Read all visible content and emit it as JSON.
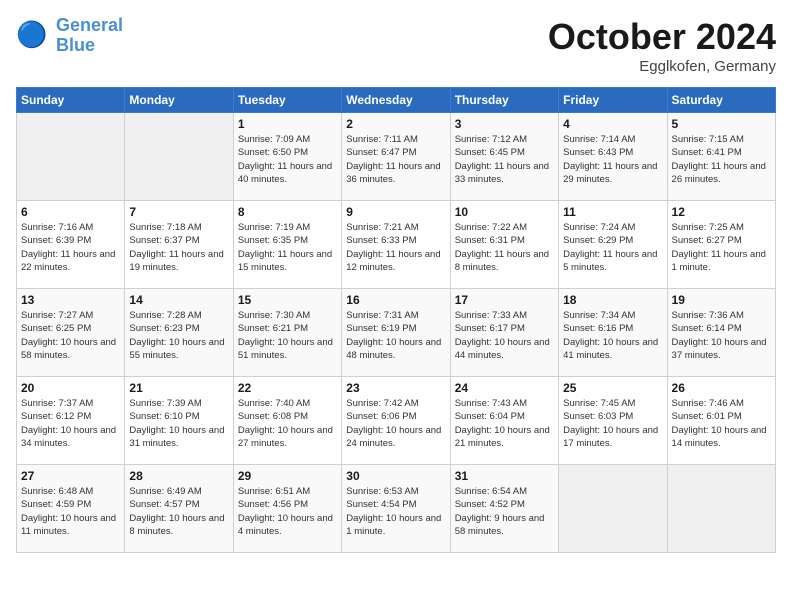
{
  "header": {
    "logo_line1": "General",
    "logo_line2": "Blue",
    "month": "October 2024",
    "location": "Egglkofen, Germany"
  },
  "weekdays": [
    "Sunday",
    "Monday",
    "Tuesday",
    "Wednesday",
    "Thursday",
    "Friday",
    "Saturday"
  ],
  "weeks": [
    [
      {
        "day": "",
        "info": ""
      },
      {
        "day": "",
        "info": ""
      },
      {
        "day": "1",
        "info": "Sunrise: 7:09 AM\nSunset: 6:50 PM\nDaylight: 11 hours and 40 minutes."
      },
      {
        "day": "2",
        "info": "Sunrise: 7:11 AM\nSunset: 6:47 PM\nDaylight: 11 hours and 36 minutes."
      },
      {
        "day": "3",
        "info": "Sunrise: 7:12 AM\nSunset: 6:45 PM\nDaylight: 11 hours and 33 minutes."
      },
      {
        "day": "4",
        "info": "Sunrise: 7:14 AM\nSunset: 6:43 PM\nDaylight: 11 hours and 29 minutes."
      },
      {
        "day": "5",
        "info": "Sunrise: 7:15 AM\nSunset: 6:41 PM\nDaylight: 11 hours and 26 minutes."
      }
    ],
    [
      {
        "day": "6",
        "info": "Sunrise: 7:16 AM\nSunset: 6:39 PM\nDaylight: 11 hours and 22 minutes."
      },
      {
        "day": "7",
        "info": "Sunrise: 7:18 AM\nSunset: 6:37 PM\nDaylight: 11 hours and 19 minutes."
      },
      {
        "day": "8",
        "info": "Sunrise: 7:19 AM\nSunset: 6:35 PM\nDaylight: 11 hours and 15 minutes."
      },
      {
        "day": "9",
        "info": "Sunrise: 7:21 AM\nSunset: 6:33 PM\nDaylight: 11 hours and 12 minutes."
      },
      {
        "day": "10",
        "info": "Sunrise: 7:22 AM\nSunset: 6:31 PM\nDaylight: 11 hours and 8 minutes."
      },
      {
        "day": "11",
        "info": "Sunrise: 7:24 AM\nSunset: 6:29 PM\nDaylight: 11 hours and 5 minutes."
      },
      {
        "day": "12",
        "info": "Sunrise: 7:25 AM\nSunset: 6:27 PM\nDaylight: 11 hours and 1 minute."
      }
    ],
    [
      {
        "day": "13",
        "info": "Sunrise: 7:27 AM\nSunset: 6:25 PM\nDaylight: 10 hours and 58 minutes."
      },
      {
        "day": "14",
        "info": "Sunrise: 7:28 AM\nSunset: 6:23 PM\nDaylight: 10 hours and 55 minutes."
      },
      {
        "day": "15",
        "info": "Sunrise: 7:30 AM\nSunset: 6:21 PM\nDaylight: 10 hours and 51 minutes."
      },
      {
        "day": "16",
        "info": "Sunrise: 7:31 AM\nSunset: 6:19 PM\nDaylight: 10 hours and 48 minutes."
      },
      {
        "day": "17",
        "info": "Sunrise: 7:33 AM\nSunset: 6:17 PM\nDaylight: 10 hours and 44 minutes."
      },
      {
        "day": "18",
        "info": "Sunrise: 7:34 AM\nSunset: 6:16 PM\nDaylight: 10 hours and 41 minutes."
      },
      {
        "day": "19",
        "info": "Sunrise: 7:36 AM\nSunset: 6:14 PM\nDaylight: 10 hours and 37 minutes."
      }
    ],
    [
      {
        "day": "20",
        "info": "Sunrise: 7:37 AM\nSunset: 6:12 PM\nDaylight: 10 hours and 34 minutes."
      },
      {
        "day": "21",
        "info": "Sunrise: 7:39 AM\nSunset: 6:10 PM\nDaylight: 10 hours and 31 minutes."
      },
      {
        "day": "22",
        "info": "Sunrise: 7:40 AM\nSunset: 6:08 PM\nDaylight: 10 hours and 27 minutes."
      },
      {
        "day": "23",
        "info": "Sunrise: 7:42 AM\nSunset: 6:06 PM\nDaylight: 10 hours and 24 minutes."
      },
      {
        "day": "24",
        "info": "Sunrise: 7:43 AM\nSunset: 6:04 PM\nDaylight: 10 hours and 21 minutes."
      },
      {
        "day": "25",
        "info": "Sunrise: 7:45 AM\nSunset: 6:03 PM\nDaylight: 10 hours and 17 minutes."
      },
      {
        "day": "26",
        "info": "Sunrise: 7:46 AM\nSunset: 6:01 PM\nDaylight: 10 hours and 14 minutes."
      }
    ],
    [
      {
        "day": "27",
        "info": "Sunrise: 6:48 AM\nSunset: 4:59 PM\nDaylight: 10 hours and 11 minutes."
      },
      {
        "day": "28",
        "info": "Sunrise: 6:49 AM\nSunset: 4:57 PM\nDaylight: 10 hours and 8 minutes."
      },
      {
        "day": "29",
        "info": "Sunrise: 6:51 AM\nSunset: 4:56 PM\nDaylight: 10 hours and 4 minutes."
      },
      {
        "day": "30",
        "info": "Sunrise: 6:53 AM\nSunset: 4:54 PM\nDaylight: 10 hours and 1 minute."
      },
      {
        "day": "31",
        "info": "Sunrise: 6:54 AM\nSunset: 4:52 PM\nDaylight: 9 hours and 58 minutes."
      },
      {
        "day": "",
        "info": ""
      },
      {
        "day": "",
        "info": ""
      }
    ]
  ]
}
